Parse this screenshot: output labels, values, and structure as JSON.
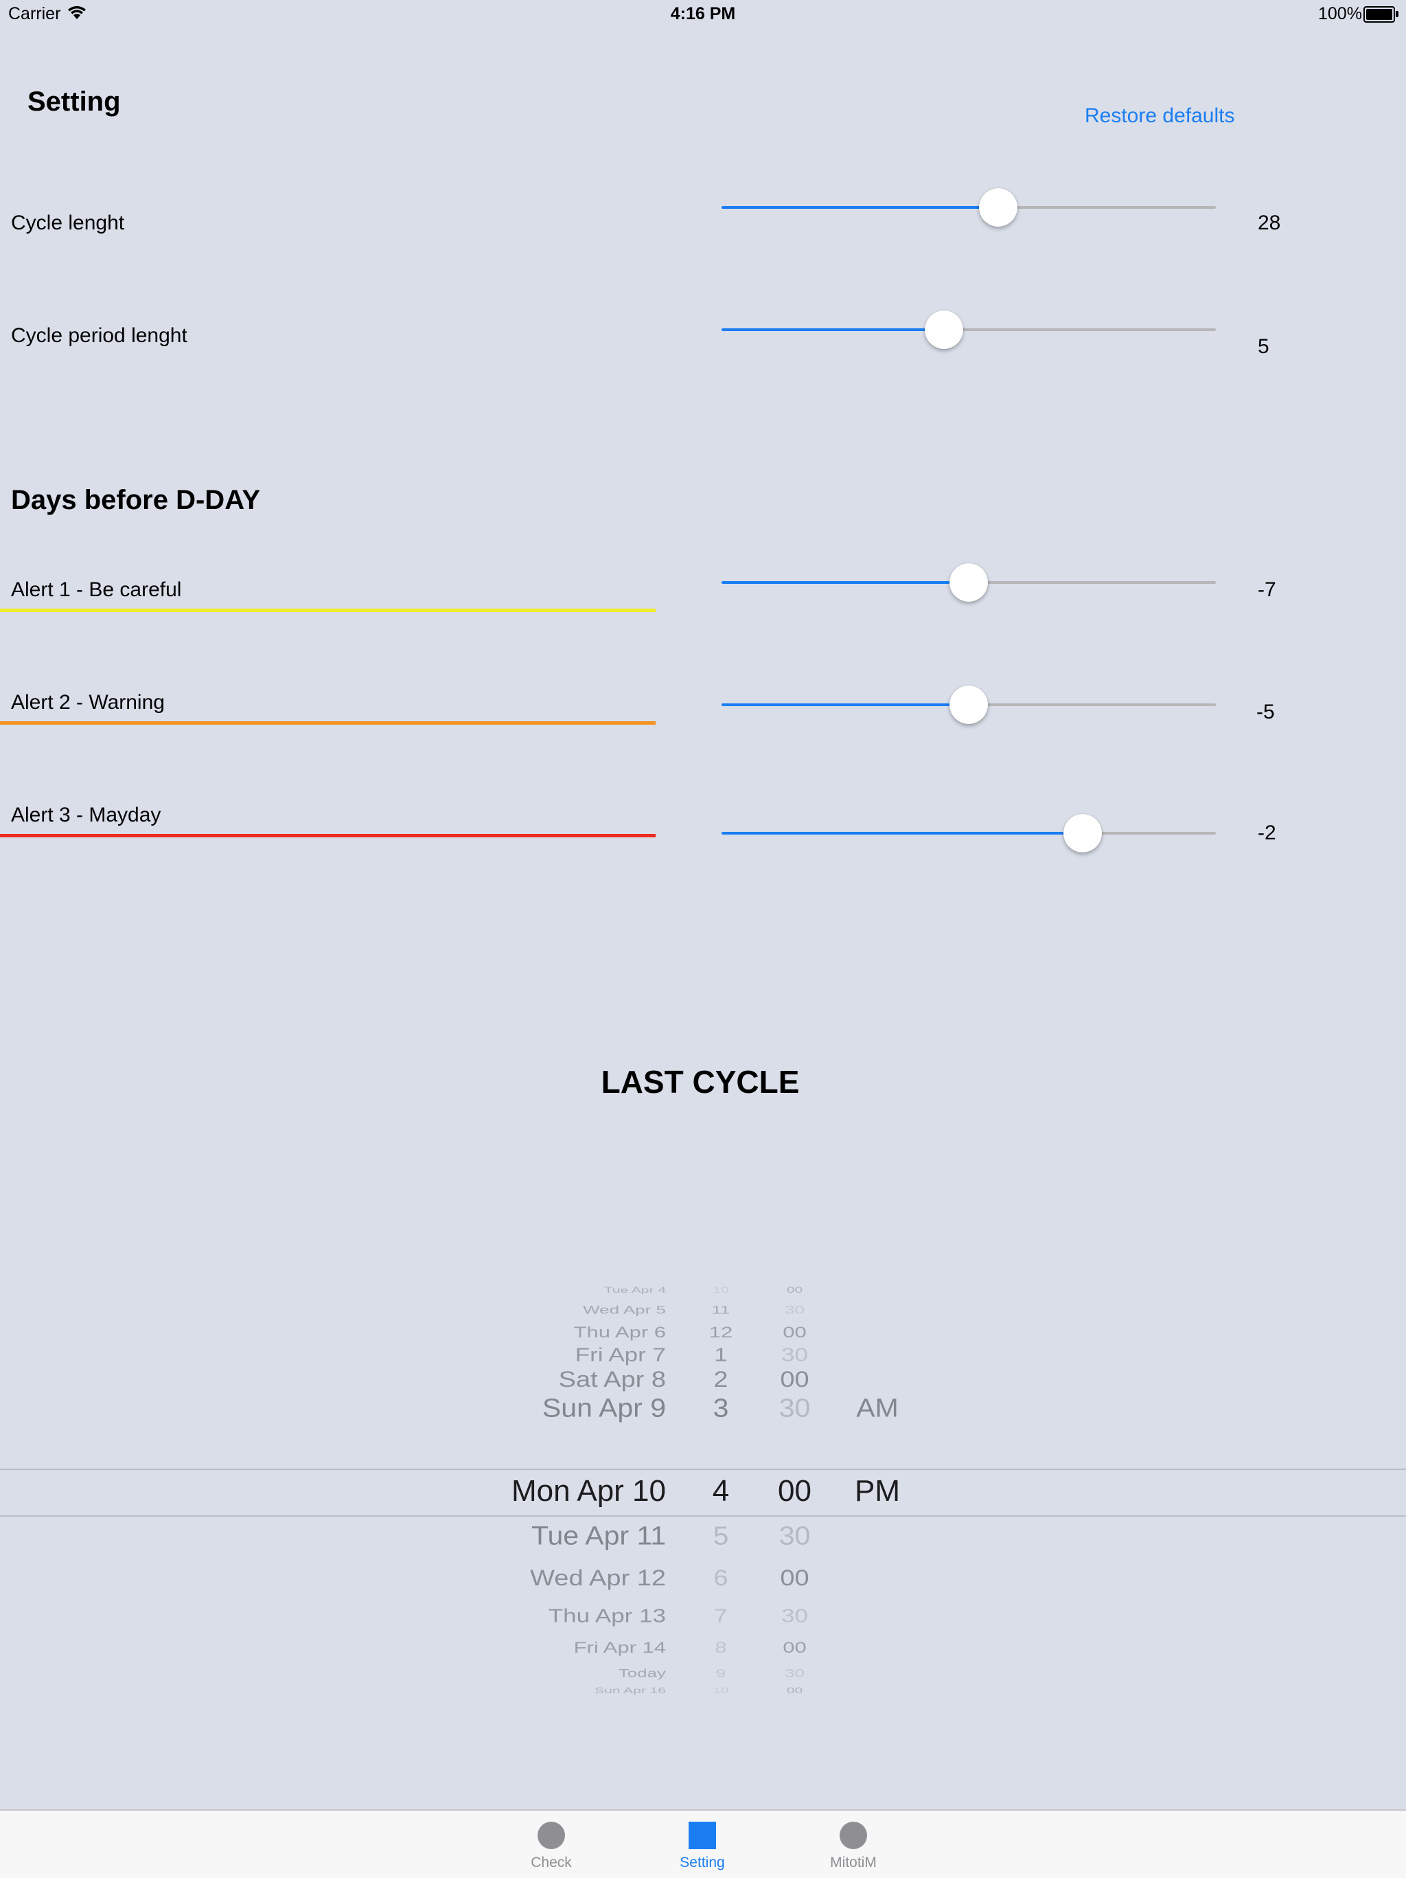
{
  "status_bar": {
    "carrier": "Carrier",
    "time": "4:16 PM",
    "battery": "100%"
  },
  "header": {
    "title": "Setting",
    "restore_label": "Restore defaults"
  },
  "settings": [
    {
      "label": "Cycle lenght",
      "value": "28",
      "slider_fraction": 0.56
    },
    {
      "label": "Cycle period lenght",
      "value": "5",
      "slider_fraction": 0.45
    }
  ],
  "alerts_section": {
    "title": "Days before D-DAY"
  },
  "alerts": [
    {
      "label": "Alert 1 - Be careful",
      "value": "-7",
      "slider_fraction": 0.5,
      "color": "#f2ec2c"
    },
    {
      "label": "Alert 2 - Warning",
      "value": "-5",
      "slider_fraction": 0.5,
      "color": "#f4931f"
    },
    {
      "label": "Alert 3 - Mayday",
      "value": "-2",
      "slider_fraction": 0.73,
      "color": "#ec2a20"
    }
  ],
  "last_cycle": {
    "title": "LAST CYCLE"
  },
  "picker": {
    "rows": [
      {
        "date": "Tue Apr 4",
        "hour": "10",
        "minute": "00",
        "ampm": ""
      },
      {
        "date": "Wed Apr 5",
        "hour": "11",
        "minute": "30",
        "ampm": ""
      },
      {
        "date": "Thu Apr 6",
        "hour": "12",
        "minute": "00",
        "ampm": ""
      },
      {
        "date": "Fri Apr 7",
        "hour": "1",
        "minute": "30",
        "ampm": ""
      },
      {
        "date": "Sat Apr 8",
        "hour": "2",
        "minute": "00",
        "ampm": ""
      },
      {
        "date": "Sun Apr 9",
        "hour": "3",
        "minute": "30",
        "ampm": "AM"
      },
      {
        "date": "Mon Apr 10",
        "hour": "4",
        "minute": "00",
        "ampm": "PM"
      },
      {
        "date": "Tue Apr 11",
        "hour": "5",
        "minute": "30",
        "ampm": ""
      },
      {
        "date": "Wed Apr 12",
        "hour": "6",
        "minute": "00",
        "ampm": ""
      },
      {
        "date": "Thu Apr 13",
        "hour": "7",
        "minute": "30",
        "ampm": ""
      },
      {
        "date": "Fri Apr 14",
        "hour": "8",
        "minute": "00",
        "ampm": ""
      },
      {
        "date": "Today",
        "hour": "9",
        "minute": "30",
        "ampm": ""
      },
      {
        "date": "Sun Apr 16",
        "hour": "10",
        "minute": "00",
        "ampm": ""
      }
    ]
  },
  "tabs": [
    {
      "label": "Check",
      "icon": "circle-icon",
      "active": false
    },
    {
      "label": "Setting",
      "icon": "square-icon",
      "active": true
    },
    {
      "label": "MitotiM",
      "icon": "circle-icon",
      "active": false
    }
  ],
  "colors": {
    "accent": "#1a7ef2",
    "background": "#d9dee9",
    "track": "#b6b6b6"
  }
}
